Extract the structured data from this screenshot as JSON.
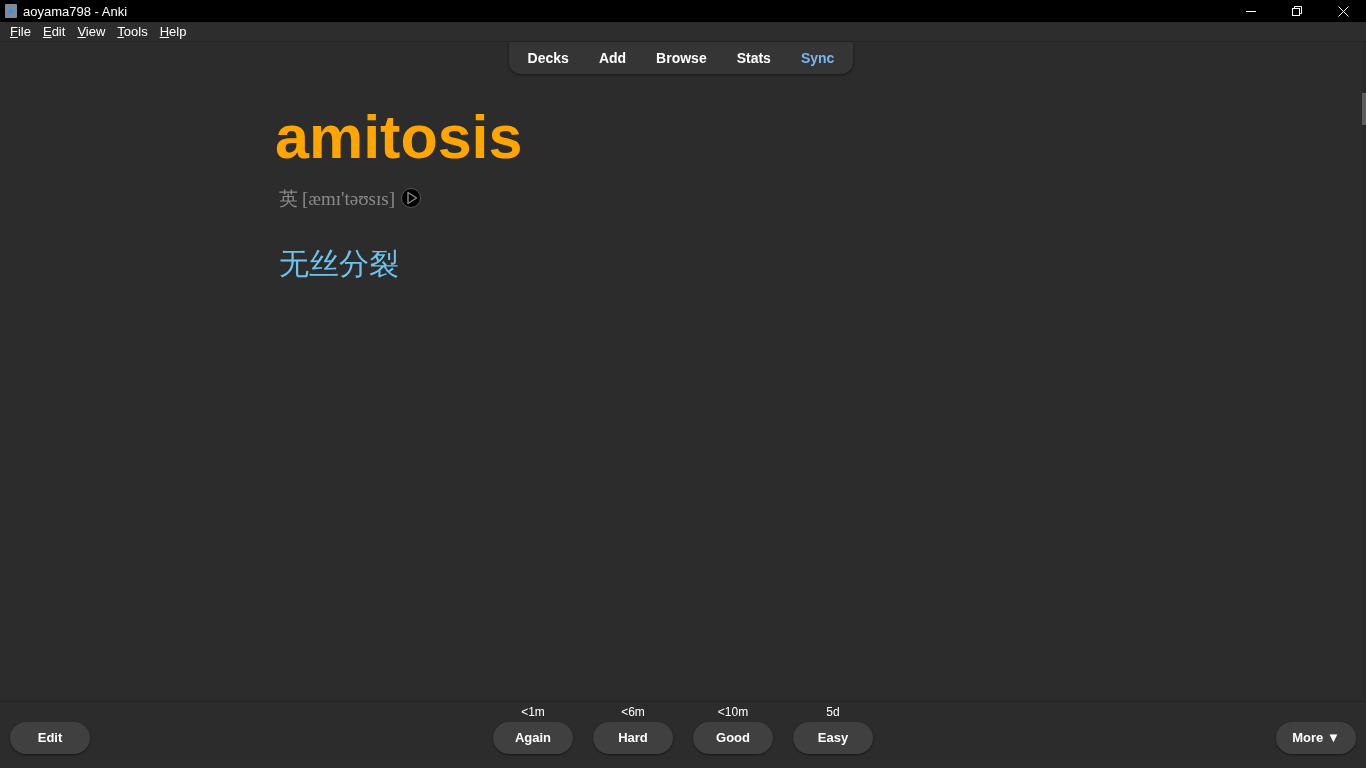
{
  "window": {
    "title": "aoyama798 - Anki"
  },
  "menu": [
    "File",
    "Edit",
    "View",
    "Tools",
    "Help"
  ],
  "toolbar": [
    {
      "label": "Decks",
      "highlight": false
    },
    {
      "label": "Add",
      "highlight": false
    },
    {
      "label": "Browse",
      "highlight": false
    },
    {
      "label": "Stats",
      "highlight": false
    },
    {
      "label": "Sync",
      "highlight": true
    }
  ],
  "card": {
    "word": "amitosis",
    "phonetic": {
      "region": "英",
      "ipa": "[æmɪ'təʊsɪs]"
    },
    "meaning": "无丝分裂"
  },
  "bottom_bar": {
    "edit_button": "Edit",
    "answers": [
      {
        "interval": "<1m",
        "label": "Again"
      },
      {
        "interval": "<6m",
        "label": "Hard"
      },
      {
        "interval": "<10m",
        "label": "Good"
      },
      {
        "interval": "5d",
        "label": "Easy"
      }
    ],
    "more_button": "More ▼"
  }
}
